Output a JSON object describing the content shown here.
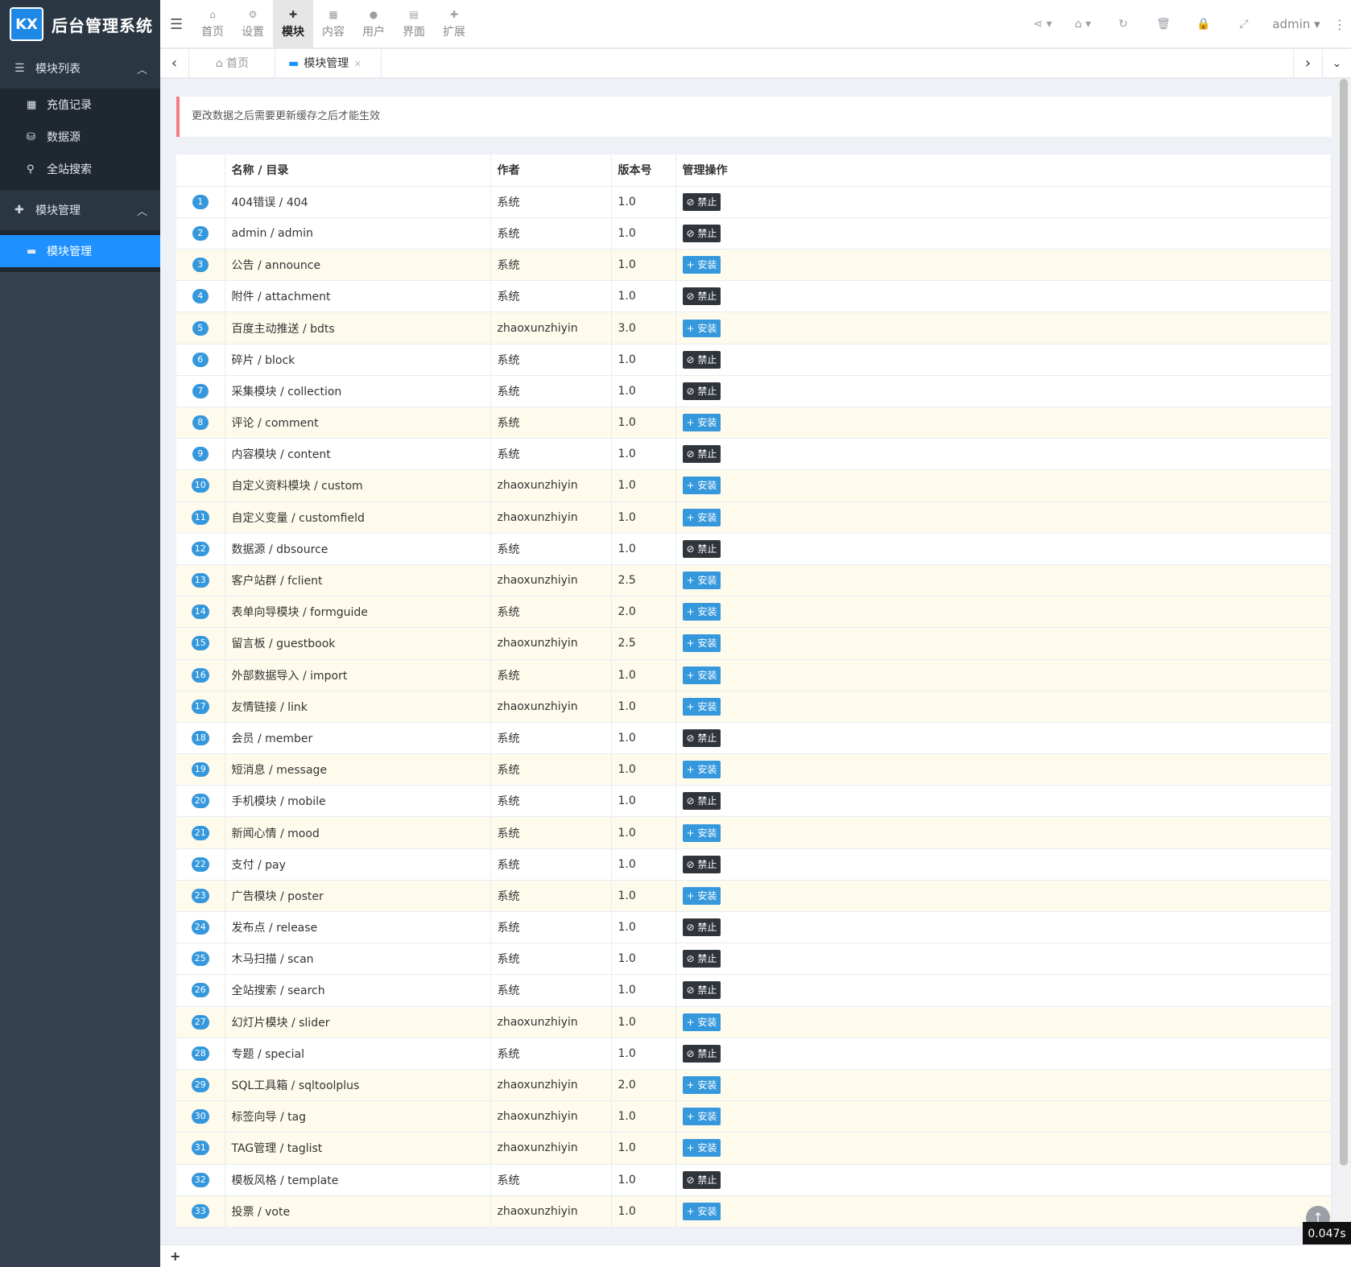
{
  "brand": {
    "logo_text": "KX",
    "title": "后台管理系统"
  },
  "sidebar": {
    "group1": {
      "label": "模块列表",
      "items": [
        {
          "icon": "calendar-icon",
          "label": "充值记录"
        },
        {
          "icon": "database-icon",
          "label": "数据源"
        },
        {
          "icon": "search-icon",
          "label": "全站搜索"
        }
      ]
    },
    "group2": {
      "label": "模块管理",
      "items": [
        {
          "icon": "folder-icon",
          "label": "模块管理"
        }
      ]
    }
  },
  "topmenu": [
    {
      "icon": "home-icon",
      "label": "首页"
    },
    {
      "icon": "cogs-icon",
      "label": "设置"
    },
    {
      "icon": "puzzle-icon",
      "label": "模块"
    },
    {
      "icon": "grid-icon",
      "label": "内容"
    },
    {
      "icon": "user-icon",
      "label": "用户"
    },
    {
      "icon": "layout-icon",
      "label": "界面"
    },
    {
      "icon": "puzzle-icon",
      "label": "扩展"
    }
  ],
  "topright": {
    "user": "admin"
  },
  "tabs": {
    "home": "首页",
    "current": "模块管理"
  },
  "alert": "更改数据之后需要更新缓存之后才能生效",
  "table": {
    "headers": [
      "",
      "名称 / 目录",
      "作者",
      "版本号",
      "管理操作"
    ],
    "btn_disable": "禁止",
    "btn_install": "安装",
    "rows": [
      {
        "n": "1",
        "name": "404错误 / 404",
        "author": "系统",
        "ver": "1.0",
        "action": "disable"
      },
      {
        "n": "2",
        "name": "admin / admin",
        "author": "系统",
        "ver": "1.0",
        "action": "disable"
      },
      {
        "n": "3",
        "name": "公告 / announce",
        "author": "系统",
        "ver": "1.0",
        "action": "install"
      },
      {
        "n": "4",
        "name": "附件 / attachment",
        "author": "系统",
        "ver": "1.0",
        "action": "disable"
      },
      {
        "n": "5",
        "name": "百度主动推送 / bdts",
        "author": "zhaoxunzhiyin",
        "ver": "3.0",
        "action": "install"
      },
      {
        "n": "6",
        "name": "碎片 / block",
        "author": "系统",
        "ver": "1.0",
        "action": "disable"
      },
      {
        "n": "7",
        "name": "采集模块 / collection",
        "author": "系统",
        "ver": "1.0",
        "action": "disable"
      },
      {
        "n": "8",
        "name": "评论 / comment",
        "author": "系统",
        "ver": "1.0",
        "action": "install"
      },
      {
        "n": "9",
        "name": "内容模块 / content",
        "author": "系统",
        "ver": "1.0",
        "action": "disable"
      },
      {
        "n": "10",
        "name": "自定义资料模块 / custom",
        "author": "zhaoxunzhiyin",
        "ver": "1.0",
        "action": "install"
      },
      {
        "n": "11",
        "name": "自定义变量 / customfield",
        "author": "zhaoxunzhiyin",
        "ver": "1.0",
        "action": "install"
      },
      {
        "n": "12",
        "name": "数据源 / dbsource",
        "author": "系统",
        "ver": "1.0",
        "action": "disable"
      },
      {
        "n": "13",
        "name": "客户站群 / fclient",
        "author": "zhaoxunzhiyin",
        "ver": "2.5",
        "action": "install"
      },
      {
        "n": "14",
        "name": "表单向导模块 / formguide",
        "author": "系统",
        "ver": "2.0",
        "action": "install"
      },
      {
        "n": "15",
        "name": "留言板 / guestbook",
        "author": "zhaoxunzhiyin",
        "ver": "2.5",
        "action": "install"
      },
      {
        "n": "16",
        "name": "外部数据导入 / import",
        "author": "系统",
        "ver": "1.0",
        "action": "install"
      },
      {
        "n": "17",
        "name": "友情链接 / link",
        "author": "zhaoxunzhiyin",
        "ver": "1.0",
        "action": "install"
      },
      {
        "n": "18",
        "name": "会员 / member",
        "author": "系统",
        "ver": "1.0",
        "action": "disable"
      },
      {
        "n": "19",
        "name": "短消息 / message",
        "author": "系统",
        "ver": "1.0",
        "action": "install"
      },
      {
        "n": "20",
        "name": "手机模块 / mobile",
        "author": "系统",
        "ver": "1.0",
        "action": "disable"
      },
      {
        "n": "21",
        "name": "新闻心情 / mood",
        "author": "系统",
        "ver": "1.0",
        "action": "install"
      },
      {
        "n": "22",
        "name": "支付 / pay",
        "author": "系统",
        "ver": "1.0",
        "action": "disable"
      },
      {
        "n": "23",
        "name": "广告模块 / poster",
        "author": "系统",
        "ver": "1.0",
        "action": "install"
      },
      {
        "n": "24",
        "name": "发布点 / release",
        "author": "系统",
        "ver": "1.0",
        "action": "disable"
      },
      {
        "n": "25",
        "name": "木马扫描 / scan",
        "author": "系统",
        "ver": "1.0",
        "action": "disable"
      },
      {
        "n": "26",
        "name": "全站搜索 / search",
        "author": "系统",
        "ver": "1.0",
        "action": "disable"
      },
      {
        "n": "27",
        "name": "幻灯片模块 / slider",
        "author": "zhaoxunzhiyin",
        "ver": "1.0",
        "action": "install"
      },
      {
        "n": "28",
        "name": "专题 / special",
        "author": "系统",
        "ver": "1.0",
        "action": "disable"
      },
      {
        "n": "29",
        "name": "SQL工具箱 / sqltoolplus",
        "author": "zhaoxunzhiyin",
        "ver": "2.0",
        "action": "install"
      },
      {
        "n": "30",
        "name": "标签向导 / tag",
        "author": "zhaoxunzhiyin",
        "ver": "1.0",
        "action": "install"
      },
      {
        "n": "31",
        "name": "TAG管理 / taglist",
        "author": "zhaoxunzhiyin",
        "ver": "1.0",
        "action": "install"
      },
      {
        "n": "32",
        "name": "模板风格 / template",
        "author": "系统",
        "ver": "1.0",
        "action": "disable"
      },
      {
        "n": "33",
        "name": "投票 / vote",
        "author": "zhaoxunzhiyin",
        "ver": "1.0",
        "action": "install"
      }
    ]
  },
  "timer": "0.047s",
  "colors": {
    "sidebar": "#364150",
    "active": "#1e90ff",
    "badge": "#3598dc",
    "dark_btn": "#2f353b",
    "yellow_row": "#fefbed"
  }
}
